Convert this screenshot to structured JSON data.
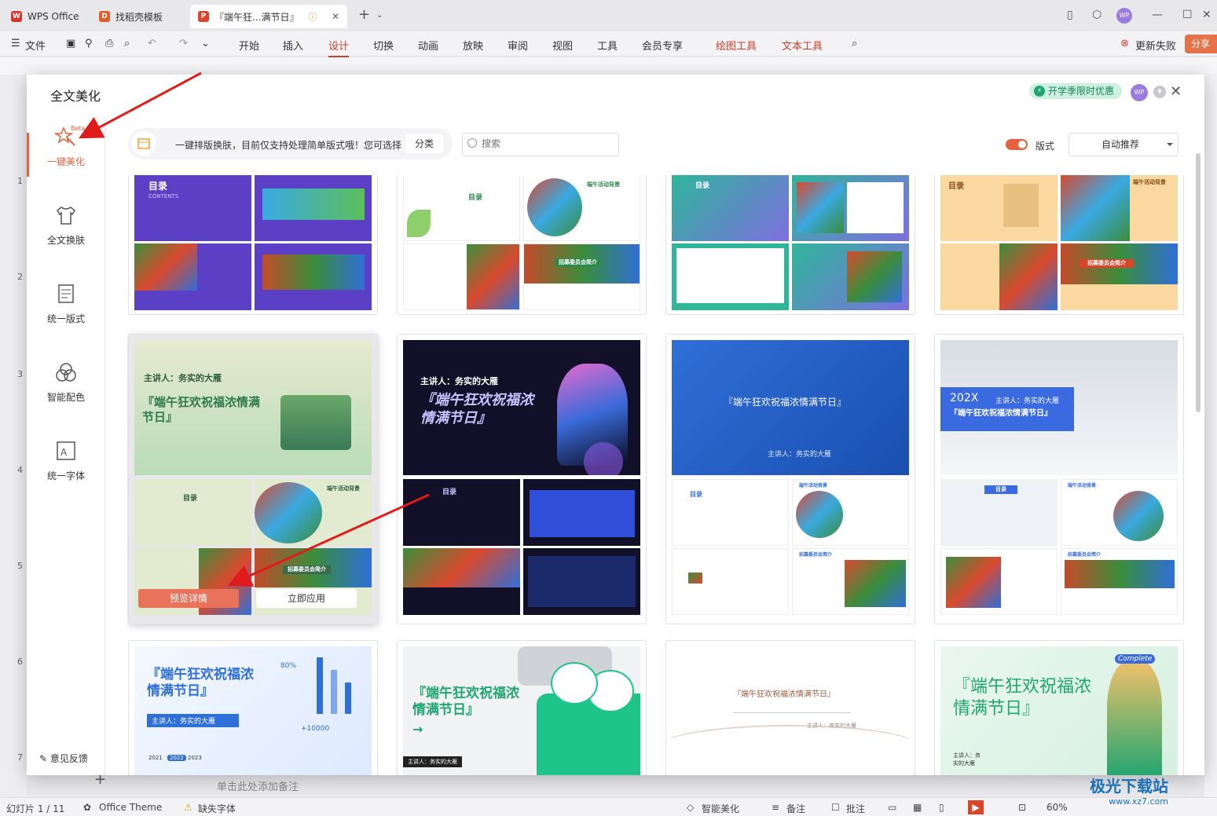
{
  "titlebar": {
    "tabs": [
      {
        "label": "WPS Office",
        "logo": "W"
      },
      {
        "label": "找稻壳模板",
        "logo": "D"
      },
      {
        "label": "『端午狂...满节日』",
        "logo": "P"
      }
    ]
  },
  "menu": {
    "file": "文件",
    "items": [
      "开始",
      "插入",
      "设计",
      "切换",
      "动画",
      "放映",
      "审阅",
      "视图",
      "工具",
      "会员专享"
    ],
    "extra": [
      "绘图工具",
      "文本工具"
    ],
    "update": "更新失败",
    "share": "分享"
  },
  "dialog": {
    "title": "全文美化",
    "promo": "开学季限时优惠",
    "avatar": "WP",
    "nav": [
      {
        "label": "一键美化",
        "badge": "Beta"
      },
      {
        "label": "全文换肤"
      },
      {
        "label": "统一版式"
      },
      {
        "label": "智能配色"
      },
      {
        "label": "统一字体"
      }
    ],
    "feedback": "意见反馈",
    "tip": "一键排版换肤，目前仅支持处理简单版式哦！您可选择",
    "category": "分类",
    "search_placeholder": "搜索",
    "toggle_label": "版式",
    "select_value": "自动推荐"
  },
  "cards": {
    "row2": [
      {
        "title": "『端午狂欢祝福浓情满节日』",
        "speaker": "主讲人：务实的大雁"
      },
      {
        "title": "『端午狂欢祝福浓情满节日』",
        "speaker": "主讲人：务实的大雁"
      },
      {
        "title": "『端午狂欢祝福浓情满节日』",
        "speaker": "主讲人：务实的大雁"
      },
      {
        "title": "『端午狂欢祝福浓情满节日』",
        "year": "202X",
        "speaker": "主讲人：务实的大雁"
      }
    ],
    "row3": [
      {
        "title": "『端午狂欢祝福浓情满节日』",
        "speaker": "主讲人：务实的大雁",
        "years": [
          "2021",
          "2022",
          "2023"
        ],
        "stat1": "80%",
        "stat2": "+10000"
      },
      {
        "title": "『端午狂欢祝福浓情满节日』",
        "speaker": "主讲人：务实的大雁"
      },
      {
        "title": "『端午狂欢祝福浓情满节日』",
        "speaker": "主讲人：务实的大雁"
      },
      {
        "title": "『端午狂欢祝福浓情满节日』",
        "speaker": "主讲人：务实的大雁",
        "badge": "Complete"
      }
    ],
    "preview": "预览详情",
    "apply": "立即应用",
    "toc": "目录",
    "contents": "CONTENTS",
    "section1": "端午活动背景",
    "section2": "招募委员会简介"
  },
  "status": {
    "slide": "幻灯片 1 / 11",
    "theme": "Office Theme",
    "font_missing": "缺失字体",
    "smart": "智能美化",
    "notes": "备注",
    "comment": "批注",
    "zoom": "60%",
    "notes_hint": "单击此处添加备注"
  },
  "row_numbers": [
    "1",
    "2",
    "3",
    "4",
    "5",
    "6",
    "7"
  ],
  "watermark": {
    "name": "极光下载站",
    "url": "www.xz7.com"
  },
  "colors": {
    "accent": "#e8603c",
    "promo": "#17845a",
    "purple": "#5b3fc4",
    "blue": "#2f6fd8"
  }
}
